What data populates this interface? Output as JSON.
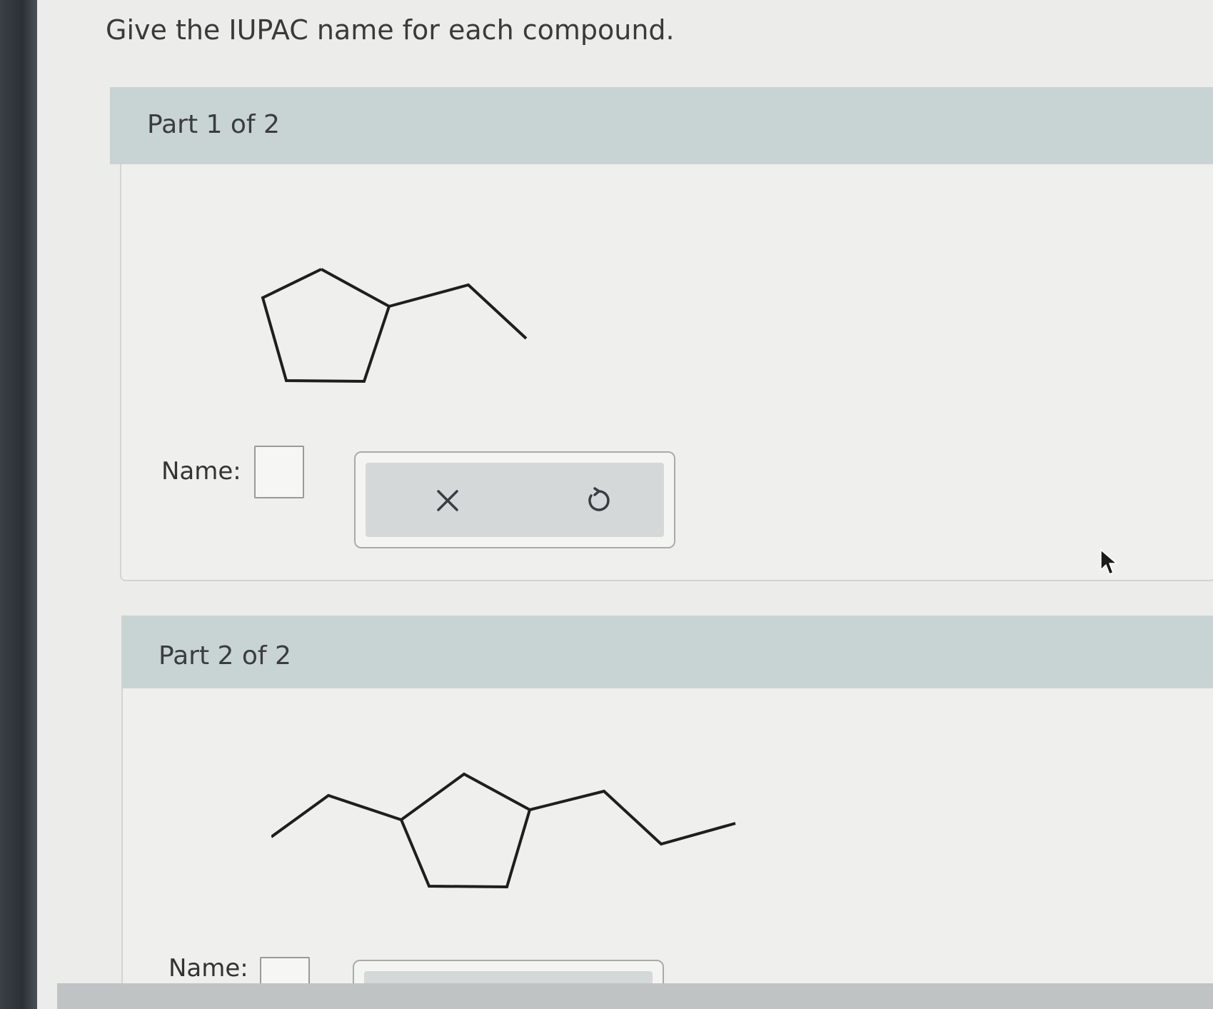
{
  "instructions": "Give the IUPAC name for each compound.",
  "parts": [
    {
      "label": "Part 1 of 2",
      "name_label": "Name:",
      "answer_value": "",
      "actions": [
        "clear-icon",
        "undo-icon"
      ]
    },
    {
      "label": "Part 2 of 2",
      "name_label": "Name:",
      "answer_value": ""
    }
  ],
  "colors": {
    "header_band": "#c8d4d4",
    "action_panel": "#d5d8d8",
    "structure_stroke": "#1e1e1e"
  }
}
